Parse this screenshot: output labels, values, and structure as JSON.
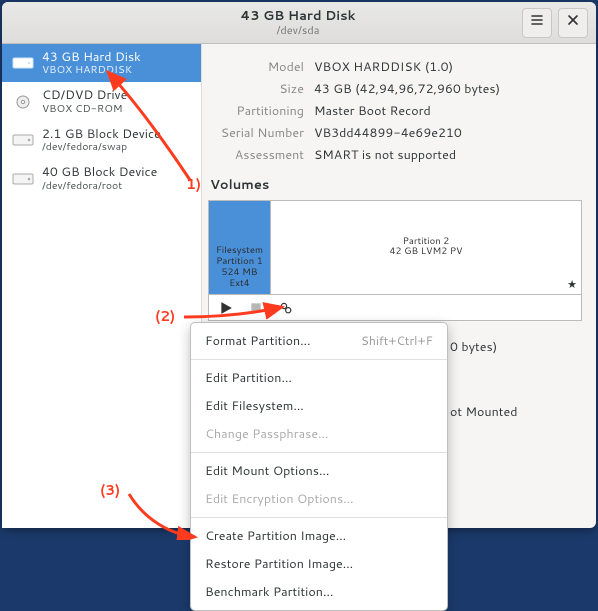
{
  "header": {
    "title": "43 GB Hard Disk",
    "subtitle": "/dev/sda"
  },
  "sidebar": {
    "items": [
      {
        "title": "43 GB Hard Disk",
        "sub": "VBOX HARDDISK",
        "icon": "hdd",
        "selected": true
      },
      {
        "title": "CD/DVD Drive",
        "sub": "VBOX CD-ROM",
        "icon": "optical",
        "selected": false
      },
      {
        "title": "2.1 GB Block Device",
        "sub": "/dev/fedora/swap",
        "icon": "hdd",
        "selected": false
      },
      {
        "title": "40 GB Block Device",
        "sub": "/dev/fedora/root",
        "icon": "hdd",
        "selected": false
      }
    ]
  },
  "details": {
    "model_k": "Model",
    "model_v": "VBOX HARDDISK (1.0)",
    "size_k": "Size",
    "size_v": "43 GB (42,94,96,72,960 bytes)",
    "part_k": "Partitioning",
    "part_v": "Master Boot Record",
    "serial_k": "Serial Number",
    "serial_v": "VB3dd44899-4e69e210",
    "assess_k": "Assessment",
    "assess_v": "SMART is not supported"
  },
  "volumes": {
    "heading": "Volumes",
    "p1_l1": "Filesystem",
    "p1_l2": "Partition 1",
    "p1_l3": "524 MB Ext4",
    "p2_l1": "Partition 2",
    "p2_l2": "42 GB LVM2 PV"
  },
  "peek": {
    "size_tail": "0 bytes)",
    "mount_tail": "ot Mounted"
  },
  "menu": {
    "format": "Format Partition…",
    "format_accel": "Shift+Ctrl+F",
    "edit_part": "Edit Partition…",
    "edit_fs": "Edit Filesystem…",
    "change_pass": "Change Passphrase…",
    "mount_opts": "Edit Mount Options…",
    "enc_opts": "Edit Encryption Options…",
    "create_img": "Create Partition Image…",
    "restore_img": "Restore Partition Image…",
    "benchmark": "Benchmark Partition…"
  },
  "annotations": {
    "a1": "1)",
    "a2": "(2)",
    "a3": "(3)"
  }
}
